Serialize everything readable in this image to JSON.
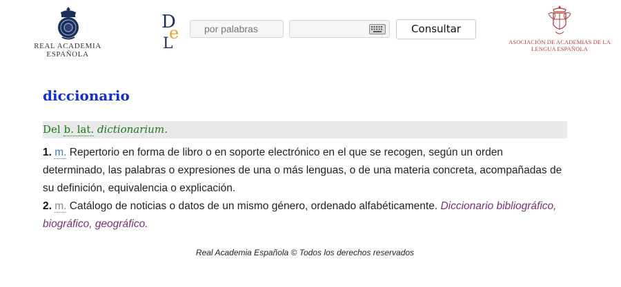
{
  "header": {
    "rae_name": "REAL ACADEMIA ESPAÑOLA",
    "search_placeholder": "por palabras",
    "consult_label": "Consultar",
    "asale_name_line1": "ASOCIACIÓN DE ACADEMIAS DE LA",
    "asale_name_line2": "LENGUA ESPAÑOLA",
    "icons": {
      "rae": "rae-crest-icon",
      "dle": "dle-logo-icon",
      "keyboard": "keyboard-icon",
      "asale": "asale-crest-icon"
    }
  },
  "entry": {
    "headword": "diccionario",
    "etymology": {
      "prefix": "Del",
      "abbr": "b. lat.",
      "etymon": "dictionarium."
    },
    "acepciones": [
      {
        "num": "1.",
        "gram": "m.",
        "text": "Repertorio en forma de libro o en soporte electrónico en el que se recogen, según un orden determinado, las palabras o expresiones de una o más lenguas, o de una materia concreta, acompañadas de su definición, equivalencia o explicación.",
        "example": ""
      },
      {
        "num": "2.",
        "gram": "m.",
        "text": "Catálogo de noticias o datos de un mismo género, ordenado alfabéticamente.",
        "example": "Diccionario bibliográfico, biográfico, geográfico."
      }
    ]
  },
  "footer": {
    "text": "Real Academia Española © Todos los derechos reservados"
  },
  "colors": {
    "headword": "#1330c9",
    "etymology": "#1a7a1a",
    "example": "#7a2f7a",
    "asale": "#b03a3a",
    "rae_crest": "#1c2e5a",
    "dle_gold": "#e3a32a"
  }
}
